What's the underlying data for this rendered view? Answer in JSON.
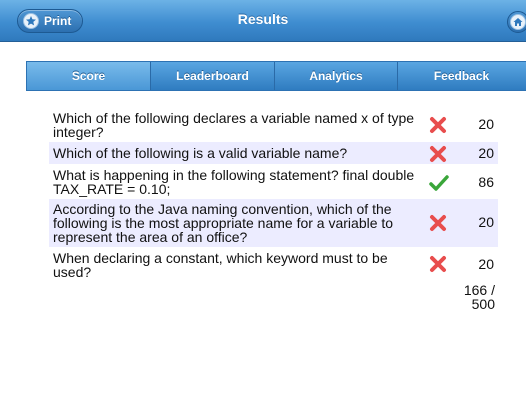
{
  "header": {
    "title": "Results",
    "print_label": "Print",
    "print_icon": "star-icon",
    "home_icon": "home-icon"
  },
  "tabs": [
    {
      "label": "Score",
      "active": true
    },
    {
      "label": "Leaderboard",
      "active": false
    },
    {
      "label": "Analytics",
      "active": false
    },
    {
      "label": "Feedback",
      "active": false
    }
  ],
  "results": [
    {
      "question": "Which of the following declares a variable named x of type integer?",
      "status": "incorrect",
      "score": "20"
    },
    {
      "question": "Which of the following is a valid variable name?",
      "status": "incorrect",
      "score": "20"
    },
    {
      "question": "What is happening in the following statement? final double TAX_RATE = 0.10;",
      "status": "correct",
      "score": "86"
    },
    {
      "question": "According to the Java naming convention, which of the following is the most appropriate name for a variable to represent the area of an office?",
      "status": "incorrect",
      "score": "20"
    },
    {
      "question": "When declaring a constant, which keyword must to be used?",
      "status": "incorrect",
      "score": "20"
    }
  ],
  "total": "166 / 500",
  "colors": {
    "header": "#3f8dd0",
    "row_shade": "#ececff",
    "incorrect": "#e84d4d",
    "correct": "#3aa63a"
  }
}
